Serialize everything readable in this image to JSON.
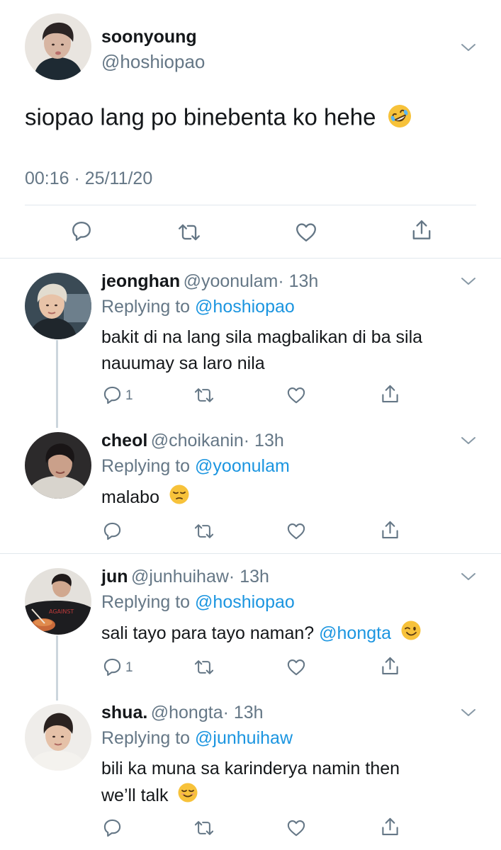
{
  "main_tweet": {
    "name": "soonyoung",
    "handle": "@hoshiopao",
    "text": "siopao lang po binebenta ko hehe",
    "timestamp": "00:16 · 25/11/20"
  },
  "replies": [
    {
      "name": "jeonghan",
      "handle": "@yoonulam",
      "time": "· 13h",
      "replying_prefix": "Replying to",
      "replying_to": "@hoshiopao",
      "line1": "bakit di na lang sila magbalikan di ba sila",
      "line2": "nauumay sa laro nila",
      "reply_count": "1"
    },
    {
      "name": "cheol",
      "handle": "@choikanin",
      "time": "· 13h",
      "replying_prefix": "Replying to",
      "replying_to": "@yoonulam",
      "line1": "malabo"
    },
    {
      "name": "jun",
      "handle": "@junhuihaw",
      "time": "· 13h",
      "replying_prefix": "Replying to",
      "replying_to": "@hoshiopao",
      "line1": "sali tayo para tayo naman?",
      "mention": "@hongta",
      "reply_count": "1"
    },
    {
      "name": "shua.",
      "handle": "@hongta",
      "time": "· 13h",
      "replying_prefix": "Replying to",
      "replying_to": "@junhuihaw",
      "line1": "bili ka muna sa karinderya namin then",
      "line2": "we’ll talk"
    }
  ],
  "icons": [
    "chevron-down-icon",
    "reply-icon",
    "retweet-icon",
    "like-icon",
    "share-icon",
    "rofl-emoji",
    "pensive-emoji",
    "wink-emoji",
    "relieved-emoji"
  ],
  "colors": {
    "text": "#14171a",
    "muted": "#657786",
    "link": "#1b95e0",
    "divider": "#e1e8ed"
  }
}
